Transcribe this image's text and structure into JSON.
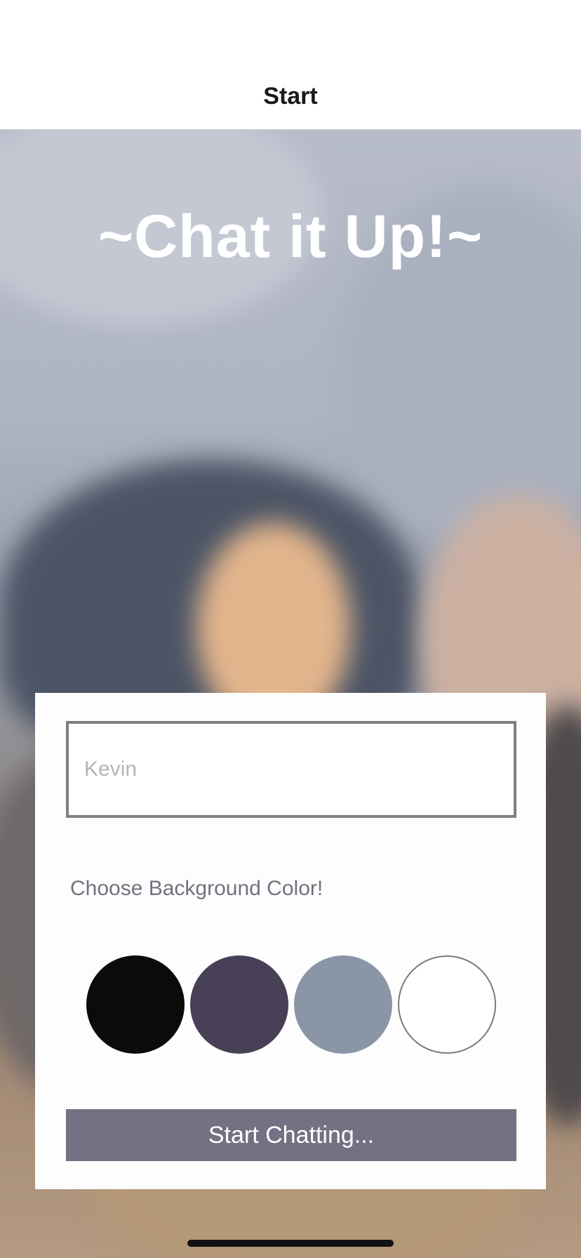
{
  "nav": {
    "title": "Start"
  },
  "app": {
    "title": "~Chat it Up!~"
  },
  "form": {
    "name_input": {
      "value": "",
      "placeholder": "Kevin"
    },
    "color_label": "Choose Background Color!",
    "color_options": [
      {
        "name": "black",
        "color": "#090c08"
      },
      {
        "name": "dark-purple",
        "color": "#474056"
      },
      {
        "name": "grey-blue",
        "color": "#8a95a5"
      },
      {
        "name": "white",
        "color": "#ffffff"
      }
    ],
    "start_button": {
      "label": "Start Chatting...",
      "color": "#757083"
    }
  },
  "colors": {
    "nav_background": "#ffffff",
    "card_background": "#fdfdfd",
    "title_text": "#ffffff",
    "label_text": "#73717e"
  }
}
